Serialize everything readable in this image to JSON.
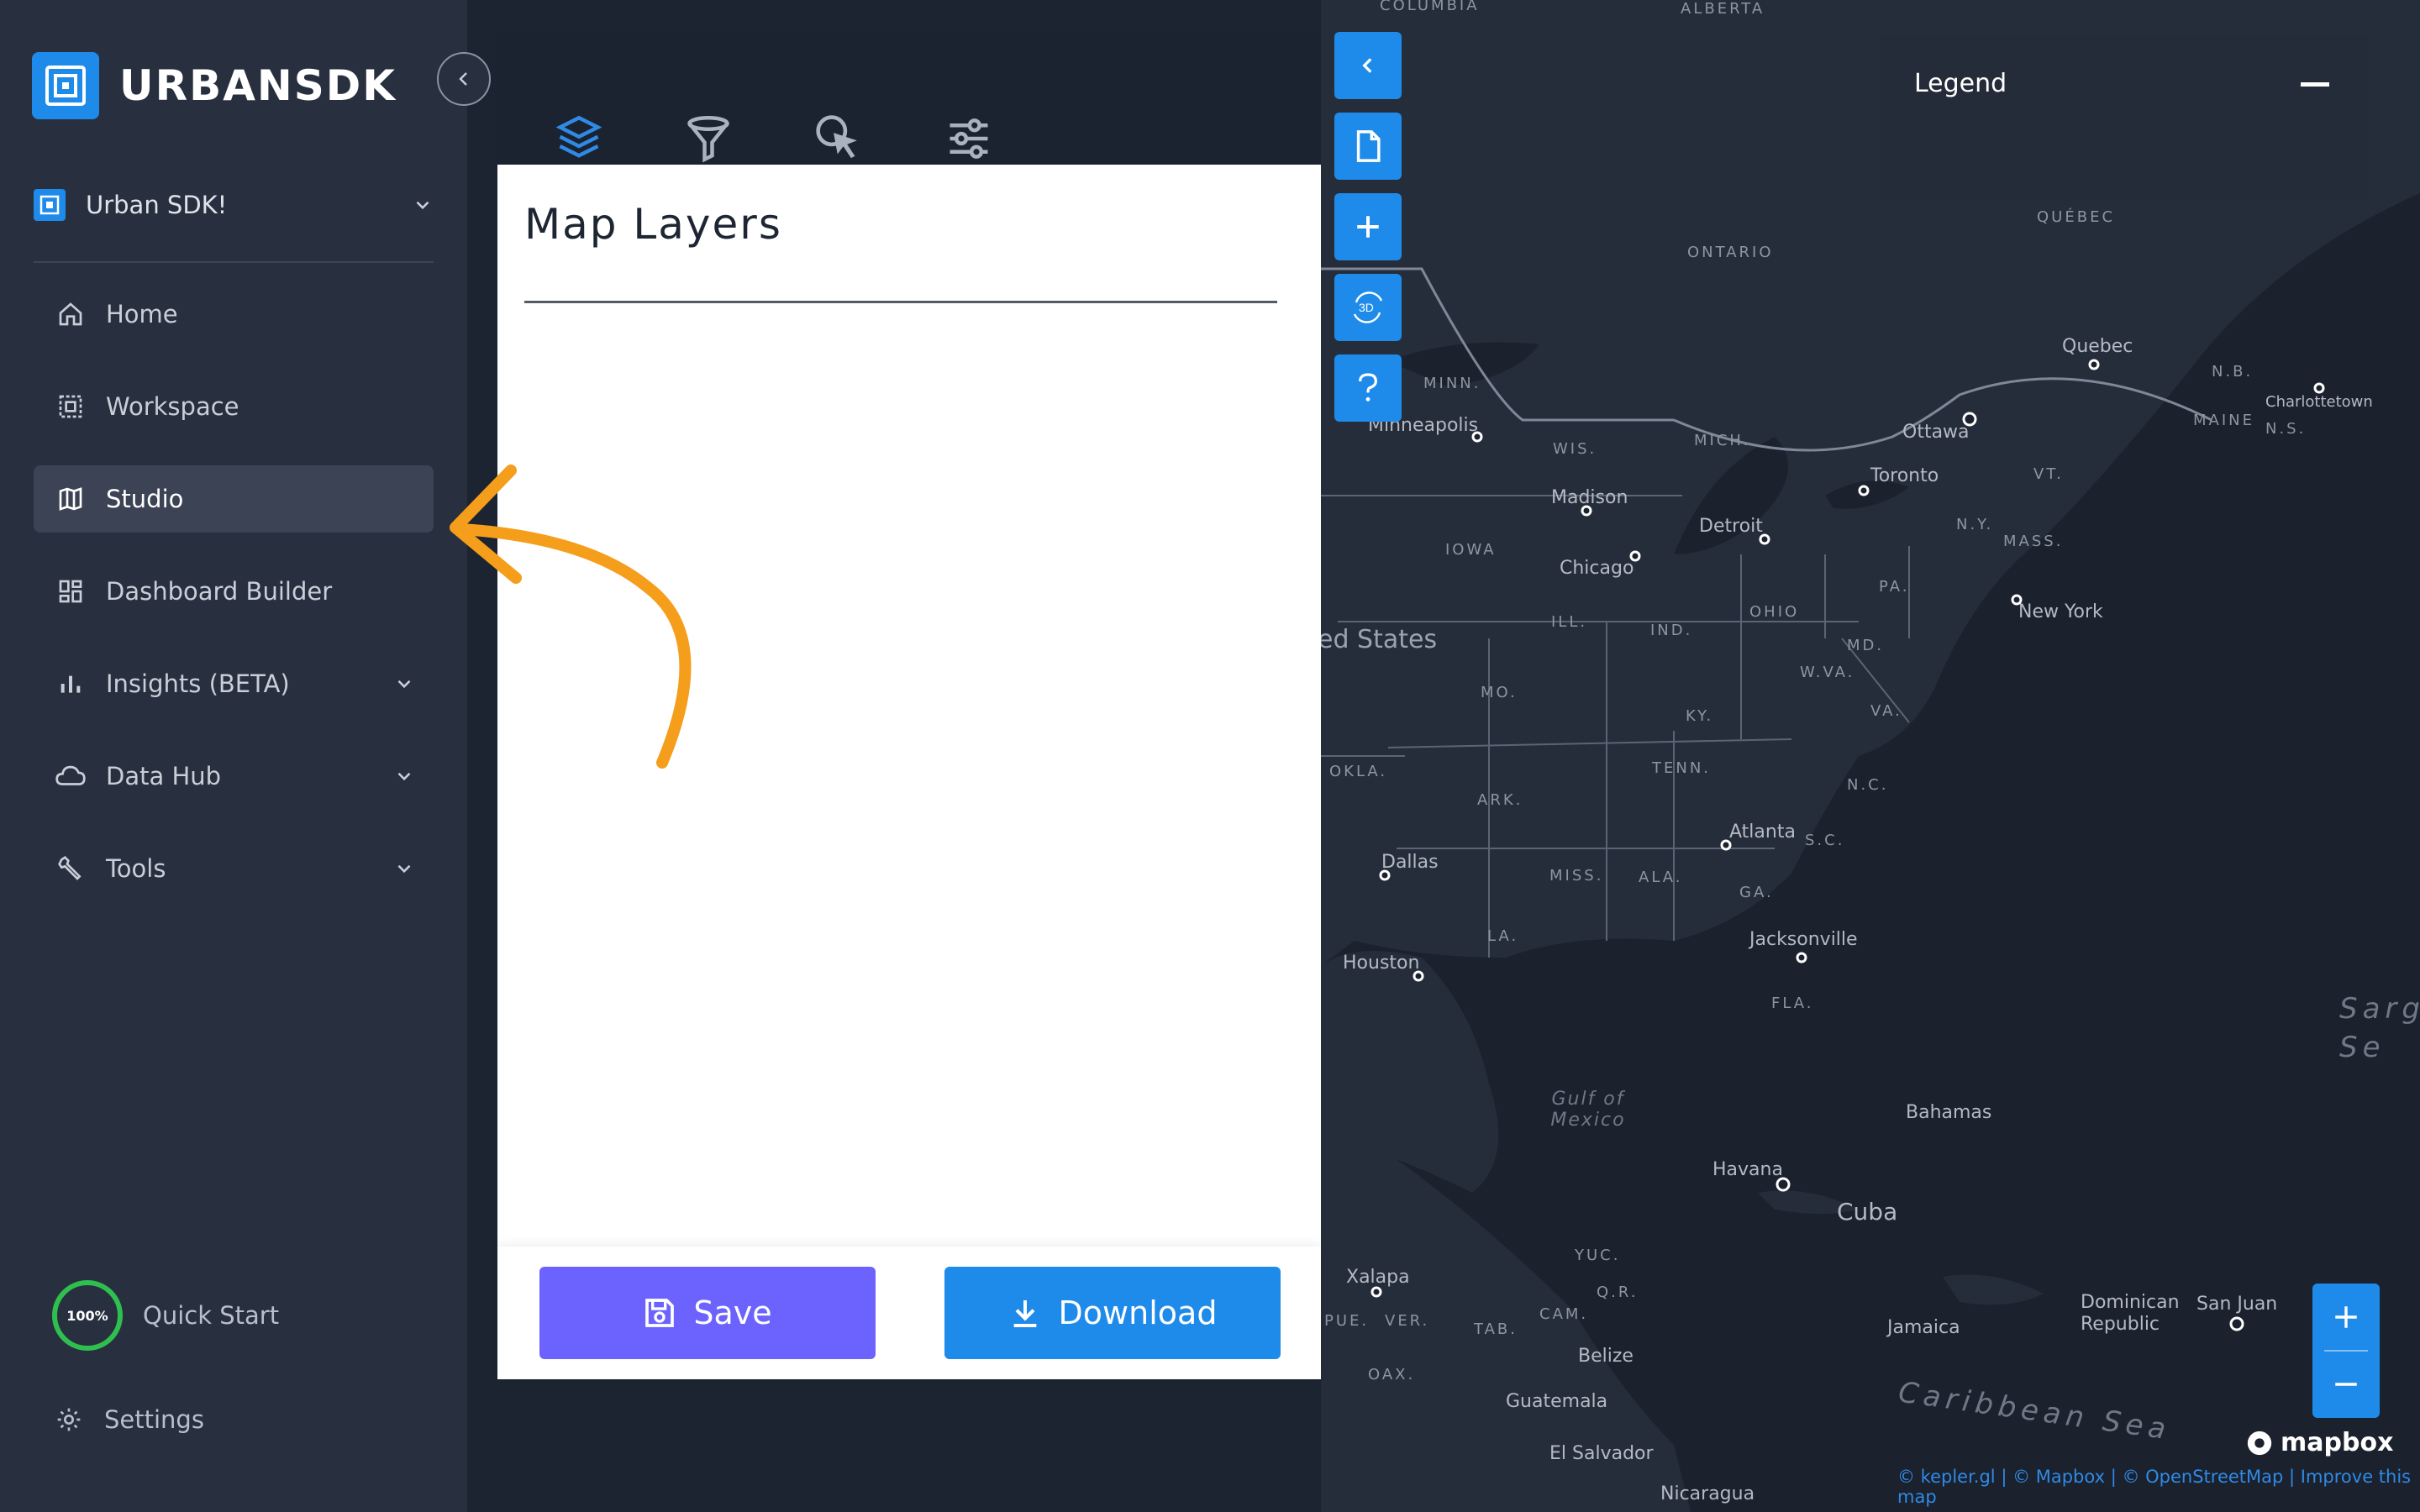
{
  "brand": {
    "name": "URBANSDK"
  },
  "org": {
    "label": "Urban SDK!"
  },
  "nav": {
    "items": [
      {
        "label": "Home",
        "icon": "home-icon"
      },
      {
        "label": "Workspace",
        "icon": "workspace-icon"
      },
      {
        "label": "Studio",
        "icon": "map-icon"
      },
      {
        "label": "Dashboard Builder",
        "icon": "dashboard-icon"
      },
      {
        "label": "Insights (BETA)",
        "icon": "bar-chart-icon"
      },
      {
        "label": "Data Hub",
        "icon": "cloud-icon"
      },
      {
        "label": "Tools",
        "icon": "wrench-icon"
      }
    ]
  },
  "quickstart": {
    "label": "Quick Start",
    "progress": "100%"
  },
  "settings": {
    "label": "Settings"
  },
  "panel": {
    "title": "Map Layers",
    "tabs": [
      "layers",
      "filter",
      "interactions",
      "settings"
    ],
    "save_label": "Save",
    "download_label": "Download"
  },
  "legend": {
    "title": "Legend"
  },
  "map": {
    "labels": [
      "ALBERTA",
      "COLUMBIA",
      "ONTARIO",
      "QUÉBEC",
      "Quebec",
      "Ottawa",
      "Toronto",
      "Minneapolis",
      "Madison",
      "Chicago",
      "Detroit",
      "New York",
      "Charlottetown",
      "MAINE",
      "N.B.",
      "N.S.",
      "VT.",
      "N.Y.",
      "MASS.",
      "PA.",
      "OHIO",
      "IND.",
      "ILL.",
      "IOWA",
      "WIS.",
      "MICH.",
      "MINN.",
      "MO.",
      "KY.",
      "W.VA.",
      "VA.",
      "MD.",
      "TENN.",
      "N.C.",
      "ARK.",
      "OKLA.",
      "ed States",
      "Dallas",
      "Houston",
      "MISS.",
      "ALA.",
      "GA.",
      "S.C.",
      "Atlanta",
      "LA.",
      "Jacksonville",
      "FLA.",
      "Gulf of Mexico",
      "Bahamas",
      "Havana",
      "Cuba",
      "Xalapa",
      "YUC.",
      "Q.R.",
      "CAM.",
      "TAB.",
      "PUE.",
      "VER.",
      "OAX.",
      "Belize",
      "Guatemala",
      "El Salvador",
      "Nicaragua",
      "Jamaica",
      "Dominican Republic",
      "San Juan",
      "Caribbean Sea",
      "Sarg Se"
    ],
    "attribution": "© kepler.gl | © Mapbox | © OpenStreetMap | Improve this map",
    "mapbox_logo": "mapbox"
  },
  "colors": {
    "accent": "#1e8bea",
    "save": "#6c63ff",
    "sidebar": "#28303f",
    "map": "#1d2431",
    "arrow": "#f59e1b",
    "progress": "#2fbf4f"
  }
}
